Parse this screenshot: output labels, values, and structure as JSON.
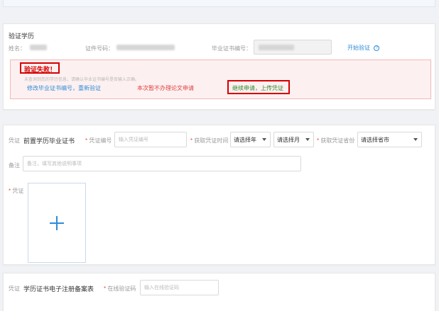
{
  "verify_section": {
    "title": "验证学历",
    "name_label": "姓名：",
    "id_label": "证件号码：",
    "cert_label": "毕业证书编号：",
    "start_verify_link": "开始验证",
    "fail_title": "验证失败！",
    "fail_message": "未查询到您的学历信息，请确认毕业证书编号是否输入正确。",
    "modify_link": "修改毕业证书编号，重新验证",
    "skip_link": "本次暂不办理论文申请",
    "continue_link": "继续申请，上传凭证"
  },
  "proof_section": {
    "prefix": "凭证",
    "title": "前置学历毕业证书",
    "proof_no_label": "凭证编号",
    "proof_no_placeholder": "输入凭证编号",
    "time_label": "获取凭证时间",
    "year_select": "请选择年",
    "month_select": "请选择月",
    "province_label": "获取凭证省份",
    "province_select": "请选择省市",
    "remark_label": "备注",
    "remark_placeholder": "备注，填写其他说明事项",
    "upload_label": "凭证"
  },
  "report_section": {
    "prefix": "凭证",
    "title": "学历证书电子注册备案表",
    "code_label": "在线验证码",
    "code_placeholder": "输入在线验证码"
  },
  "colors": {
    "accent": "#2f8cd8",
    "error": "#d40000",
    "success": "#2e8b2e"
  }
}
